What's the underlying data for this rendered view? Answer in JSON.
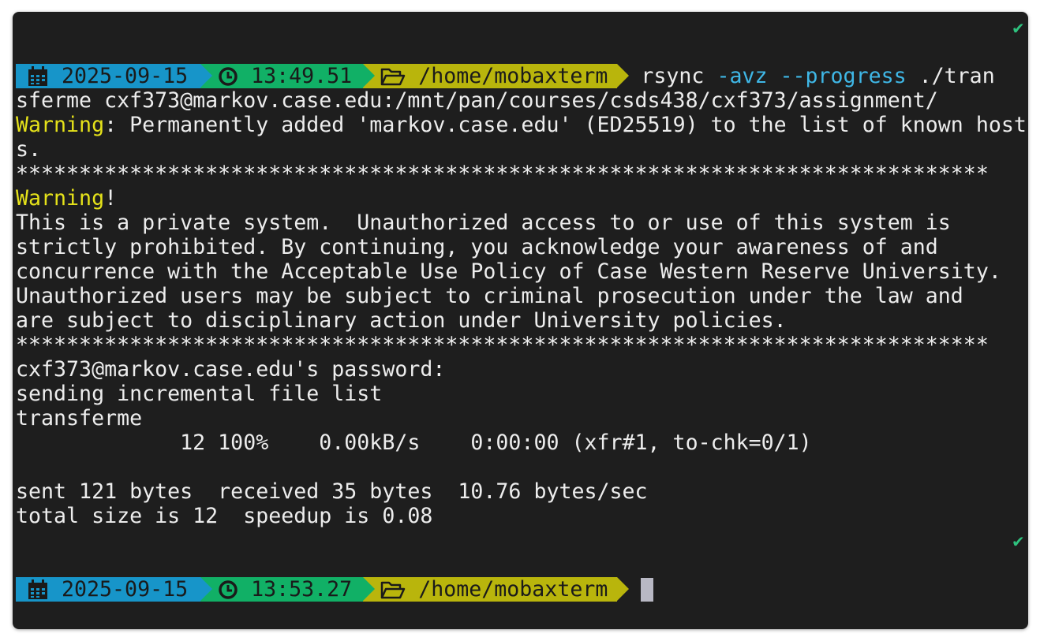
{
  "prompt1": {
    "date": "2025-09-15",
    "time": "13:49.51",
    "path": "/home/mobaxterm",
    "cmd_name": "rsync",
    "cmd_flags": "-avz --progress",
    "cmd_rest": "./tran"
  },
  "lines": {
    "cmd_wrap": "sferme cxf373@markov.case.edu:/mnt/pan/courses/csds438/cxf373/assignment/",
    "warning_label": "Warning",
    "warning_rest": ": Permanently added 'markov.case.edu' (ED25519) to the list of known host",
    "warning_wrap": "s.",
    "stars": "*****************************************************************************",
    "banner_warning": "Warning",
    "banner_bang": "!",
    "banner_1": "This is a private system.  Unauthorized access to or use of this system is",
    "banner_2": "strictly prohibited. By continuing, you acknowledge your awareness of and",
    "banner_3": "concurrence with the Acceptable Use Policy of Case Western Reserve University.",
    "banner_4": "Unauthorized users may be subject to criminal prosecution under the law and",
    "banner_5": "are subject to disciplinary action under University policies.",
    "password": "cxf373@markov.case.edu's password:",
    "sending": "sending incremental file list",
    "file": "transferme",
    "progress": "             12 100%    0.00kB/s    0:00:00 (xfr#1, to-chk=0/1)",
    "sent": "sent 121 bytes  received 35 bytes  10.76 bytes/sec",
    "total": "total size is 12  speedup is 0.08"
  },
  "prompt2": {
    "date": "2025-09-15",
    "time": "13:53.27",
    "path": "/home/mobaxterm"
  },
  "status_check": "✔",
  "icons": {
    "date": "calendar-icon",
    "time": "clock-icon",
    "path": "folder-open-icon",
    "status": "check-icon"
  },
  "colors": {
    "background": "#1e1e1e",
    "text": "#ededed",
    "date_segment": "#1795c9",
    "time_segment": "#11b066",
    "path_segment": "#b9b50c",
    "flag": "#3fb7e6",
    "warning": "#e5e21a",
    "check": "#2ec27e"
  }
}
